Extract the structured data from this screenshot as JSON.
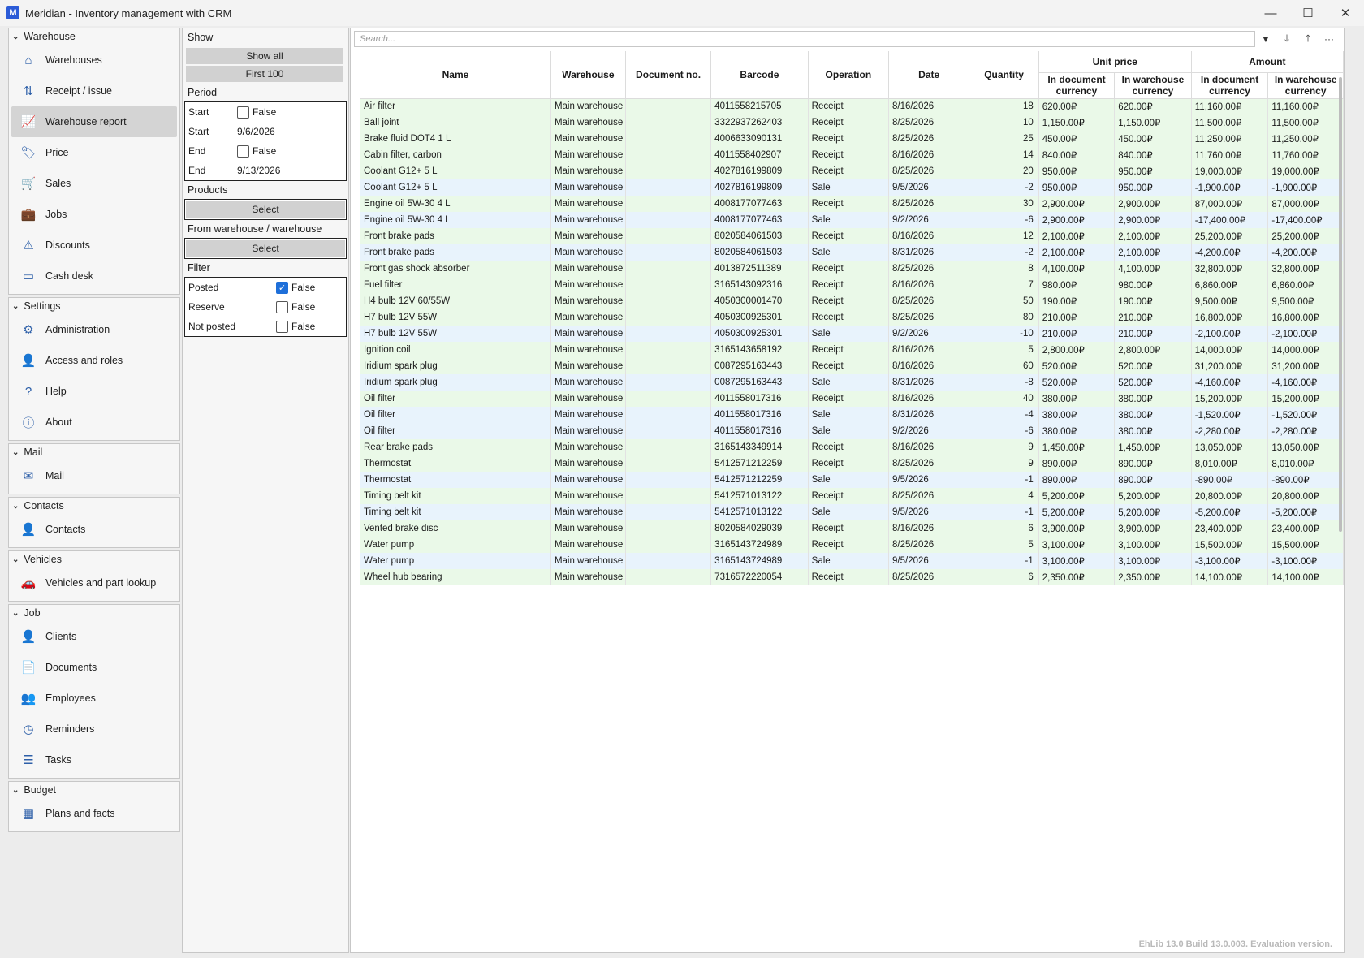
{
  "window": {
    "title": "Meridian - Inventory management with CRM",
    "logo_letter": "M"
  },
  "sidebar": {
    "groups": [
      {
        "label": "Warehouse",
        "items": [
          {
            "label": "Warehouses",
            "icon": "warehouse-icon"
          },
          {
            "label": "Receipt / issue",
            "icon": "transfer-icon"
          },
          {
            "label": "Warehouse report",
            "icon": "chart-icon",
            "active": true
          },
          {
            "label": "Price",
            "icon": "tag-icon"
          },
          {
            "label": "Sales",
            "icon": "cart-icon"
          },
          {
            "label": "Jobs",
            "icon": "briefcase-icon"
          },
          {
            "label": "Discounts",
            "icon": "warning-icon"
          },
          {
            "label": "Cash desk",
            "icon": "register-icon"
          }
        ]
      },
      {
        "label": "Settings",
        "items": [
          {
            "label": "Administration",
            "icon": "gears-icon"
          },
          {
            "label": "Access and roles",
            "icon": "user-lock-icon"
          },
          {
            "label": "Help",
            "icon": "help-icon"
          },
          {
            "label": "About",
            "icon": "info-icon"
          }
        ]
      },
      {
        "label": "Mail",
        "items": [
          {
            "label": "Mail",
            "icon": "envelope-icon"
          }
        ]
      },
      {
        "label": "Contacts",
        "items": [
          {
            "label": "Contacts",
            "icon": "person-icon"
          }
        ]
      },
      {
        "label": "Vehicles",
        "items": [
          {
            "label": "Vehicles and part lookup",
            "icon": "car-icon"
          }
        ]
      },
      {
        "label": "Job",
        "items": [
          {
            "label": "Clients",
            "icon": "person-icon"
          },
          {
            "label": "Documents",
            "icon": "document-icon"
          },
          {
            "label": "Employees",
            "icon": "people-icon"
          },
          {
            "label": "Reminders",
            "icon": "clock-icon"
          },
          {
            "label": "Tasks",
            "icon": "tasks-icon"
          }
        ]
      },
      {
        "label": "Budget",
        "items": [
          {
            "label": "Plans and facts",
            "icon": "calculator-icon"
          }
        ]
      }
    ]
  },
  "params": {
    "show_label": "Show",
    "show_all": "Show all",
    "first_100": "First 100",
    "period_label": "Period",
    "period": [
      {
        "label": "Start",
        "value": "False",
        "checkbox": true
      },
      {
        "label": "Start",
        "value": "9/6/2026"
      },
      {
        "label": "End",
        "value": "False",
        "checkbox": true
      },
      {
        "label": "End",
        "value": "9/13/2026"
      }
    ],
    "products_label": "Products",
    "select": "Select",
    "from_warehouse_label": "From warehouse / warehouse",
    "filter_label": "Filter",
    "filters": [
      {
        "label": "Posted",
        "value": "False",
        "checked": true
      },
      {
        "label": "Reserve",
        "value": "False",
        "checked": false
      },
      {
        "label": "Not posted",
        "value": "False",
        "checked": false
      }
    ]
  },
  "search_placeholder": "Search...",
  "table": {
    "headers": {
      "name": "Name",
      "warehouse": "Warehouse",
      "doc": "Document no.",
      "barcode": "Barcode",
      "operation": "Operation",
      "date": "Date",
      "quantity": "Quantity",
      "unit_price": "Unit price",
      "amount": "Amount",
      "in_doc": "In document currency",
      "in_wh": "In warehouse currency"
    },
    "rows": [
      [
        "Air filter",
        "Main warehouse",
        "",
        "4011558215705",
        "Receipt",
        "8/16/2026",
        "18",
        "620.00₽",
        "620.00₽",
        "11,160.00₽",
        "11,160.00₽"
      ],
      [
        "Ball joint",
        "Main warehouse",
        "",
        "3322937262403",
        "Receipt",
        "8/25/2026",
        "10",
        "1,150.00₽",
        "1,150.00₽",
        "11,500.00₽",
        "11,500.00₽"
      ],
      [
        "Brake fluid DOT4 1 L",
        "Main warehouse",
        "",
        "4006633090131",
        "Receipt",
        "8/25/2026",
        "25",
        "450.00₽",
        "450.00₽",
        "11,250.00₽",
        "11,250.00₽"
      ],
      [
        "Cabin filter, carbon",
        "Main warehouse",
        "",
        "4011558402907",
        "Receipt",
        "8/16/2026",
        "14",
        "840.00₽",
        "840.00₽",
        "11,760.00₽",
        "11,760.00₽"
      ],
      [
        "Coolant G12+ 5 L",
        "Main warehouse",
        "",
        "4027816199809",
        "Receipt",
        "8/25/2026",
        "20",
        "950.00₽",
        "950.00₽",
        "19,000.00₽",
        "19,000.00₽"
      ],
      [
        "Coolant G12+ 5 L",
        "Main warehouse",
        "",
        "4027816199809",
        "Sale",
        "9/5/2026",
        "-2",
        "950.00₽",
        "950.00₽",
        "-1,900.00₽",
        "-1,900.00₽"
      ],
      [
        "Engine oil 5W-30 4 L",
        "Main warehouse",
        "",
        "4008177077463",
        "Receipt",
        "8/25/2026",
        "30",
        "2,900.00₽",
        "2,900.00₽",
        "87,000.00₽",
        "87,000.00₽"
      ],
      [
        "Engine oil 5W-30 4 L",
        "Main warehouse",
        "",
        "4008177077463",
        "Sale",
        "9/2/2026",
        "-6",
        "2,900.00₽",
        "2,900.00₽",
        "-17,400.00₽",
        "-17,400.00₽"
      ],
      [
        "Front brake pads",
        "Main warehouse",
        "",
        "8020584061503",
        "Receipt",
        "8/16/2026",
        "12",
        "2,100.00₽",
        "2,100.00₽",
        "25,200.00₽",
        "25,200.00₽"
      ],
      [
        "Front brake pads",
        "Main warehouse",
        "",
        "8020584061503",
        "Sale",
        "8/31/2026",
        "-2",
        "2,100.00₽",
        "2,100.00₽",
        "-4,200.00₽",
        "-4,200.00₽"
      ],
      [
        "Front gas shock absorber",
        "Main warehouse",
        "",
        "4013872511389",
        "Receipt",
        "8/25/2026",
        "8",
        "4,100.00₽",
        "4,100.00₽",
        "32,800.00₽",
        "32,800.00₽"
      ],
      [
        "Fuel filter",
        "Main warehouse",
        "",
        "3165143092316",
        "Receipt",
        "8/16/2026",
        "7",
        "980.00₽",
        "980.00₽",
        "6,860.00₽",
        "6,860.00₽"
      ],
      [
        "H4 bulb 12V 60/55W",
        "Main warehouse",
        "",
        "4050300001470",
        "Receipt",
        "8/25/2026",
        "50",
        "190.00₽",
        "190.00₽",
        "9,500.00₽",
        "9,500.00₽"
      ],
      [
        "H7 bulb 12V 55W",
        "Main warehouse",
        "",
        "4050300925301",
        "Receipt",
        "8/25/2026",
        "80",
        "210.00₽",
        "210.00₽",
        "16,800.00₽",
        "16,800.00₽"
      ],
      [
        "H7 bulb 12V 55W",
        "Main warehouse",
        "",
        "4050300925301",
        "Sale",
        "9/2/2026",
        "-10",
        "210.00₽",
        "210.00₽",
        "-2,100.00₽",
        "-2,100.00₽"
      ],
      [
        "Ignition coil",
        "Main warehouse",
        "",
        "3165143658192",
        "Receipt",
        "8/16/2026",
        "5",
        "2,800.00₽",
        "2,800.00₽",
        "14,000.00₽",
        "14,000.00₽"
      ],
      [
        "Iridium spark plug",
        "Main warehouse",
        "",
        "0087295163443",
        "Receipt",
        "8/16/2026",
        "60",
        "520.00₽",
        "520.00₽",
        "31,200.00₽",
        "31,200.00₽"
      ],
      [
        "Iridium spark plug",
        "Main warehouse",
        "",
        "0087295163443",
        "Sale",
        "8/31/2026",
        "-8",
        "520.00₽",
        "520.00₽",
        "-4,160.00₽",
        "-4,160.00₽"
      ],
      [
        "Oil filter",
        "Main warehouse",
        "",
        "4011558017316",
        "Receipt",
        "8/16/2026",
        "40",
        "380.00₽",
        "380.00₽",
        "15,200.00₽",
        "15,200.00₽"
      ],
      [
        "Oil filter",
        "Main warehouse",
        "",
        "4011558017316",
        "Sale",
        "8/31/2026",
        "-4",
        "380.00₽",
        "380.00₽",
        "-1,520.00₽",
        "-1,520.00₽"
      ],
      [
        "Oil filter",
        "Main warehouse",
        "",
        "4011558017316",
        "Sale",
        "9/2/2026",
        "-6",
        "380.00₽",
        "380.00₽",
        "-2,280.00₽",
        "-2,280.00₽"
      ],
      [
        "Rear brake pads",
        "Main warehouse",
        "",
        "3165143349914",
        "Receipt",
        "8/16/2026",
        "9",
        "1,450.00₽",
        "1,450.00₽",
        "13,050.00₽",
        "13,050.00₽"
      ],
      [
        "Thermostat",
        "Main warehouse",
        "",
        "5412571212259",
        "Receipt",
        "8/25/2026",
        "9",
        "890.00₽",
        "890.00₽",
        "8,010.00₽",
        "8,010.00₽"
      ],
      [
        "Thermostat",
        "Main warehouse",
        "",
        "5412571212259",
        "Sale",
        "9/5/2026",
        "-1",
        "890.00₽",
        "890.00₽",
        "-890.00₽",
        "-890.00₽"
      ],
      [
        "Timing belt kit",
        "Main warehouse",
        "",
        "5412571013122",
        "Receipt",
        "8/25/2026",
        "4",
        "5,200.00₽",
        "5,200.00₽",
        "20,800.00₽",
        "20,800.00₽"
      ],
      [
        "Timing belt kit",
        "Main warehouse",
        "",
        "5412571013122",
        "Sale",
        "9/5/2026",
        "-1",
        "5,200.00₽",
        "5,200.00₽",
        "-5,200.00₽",
        "-5,200.00₽"
      ],
      [
        "Vented brake disc",
        "Main warehouse",
        "",
        "8020584029039",
        "Receipt",
        "8/16/2026",
        "6",
        "3,900.00₽",
        "3,900.00₽",
        "23,400.00₽",
        "23,400.00₽"
      ],
      [
        "Water pump",
        "Main warehouse",
        "",
        "3165143724989",
        "Receipt",
        "8/25/2026",
        "5",
        "3,100.00₽",
        "3,100.00₽",
        "15,500.00₽",
        "15,500.00₽"
      ],
      [
        "Water pump",
        "Main warehouse",
        "",
        "3165143724989",
        "Sale",
        "9/5/2026",
        "-1",
        "3,100.00₽",
        "3,100.00₽",
        "-3,100.00₽",
        "-3,100.00₽"
      ],
      [
        "Wheel hub bearing",
        "Main warehouse",
        "",
        "7316572220054",
        "Receipt",
        "8/25/2026",
        "6",
        "2,350.00₽",
        "2,350.00₽",
        "14,100.00₽",
        "14,100.00₽"
      ]
    ]
  },
  "footer_note": "EhLib 13.0 Build 13.0.003. Evaluation version."
}
